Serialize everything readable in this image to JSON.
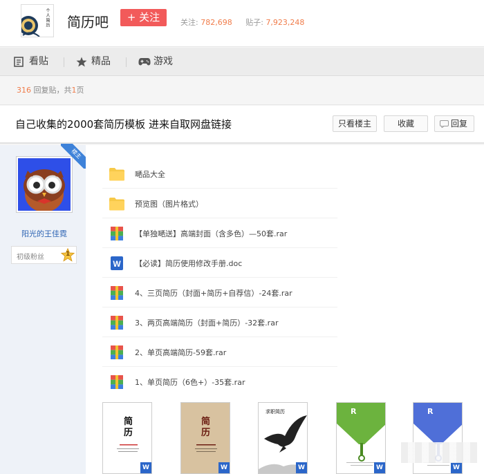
{
  "forum": {
    "logo_text": "个人简历",
    "name": "简历吧",
    "follow_label": "+ 关注",
    "follow_count_label": "关注:",
    "follow_count": "782,698",
    "post_count_label": "贴子:",
    "post_count": "7,923,248"
  },
  "tabs": [
    {
      "label": "看贴",
      "icon": "document-icon"
    },
    {
      "label": "精品",
      "icon": "star-icon"
    },
    {
      "label": "游戏",
      "icon": "gamepad-icon"
    }
  ],
  "reply_summary": {
    "count": "316",
    "reply_label": "回复贴，共",
    "pages": "1",
    "pages_suffix": "页"
  },
  "thread": {
    "title": "自己收集的2000套简历模板 进来自取网盘链接",
    "only_op_label": "只看楼主",
    "collect_label": "收藏",
    "reply_label": "回复"
  },
  "author": {
    "badge": "楼主",
    "name": "阳光的王佳霓",
    "level_label": "初级粉丝",
    "level": "1"
  },
  "files": [
    {
      "name": "嗮品大全",
      "type": "folder"
    },
    {
      "name": "预览图（图片格式）",
      "type": "folder"
    },
    {
      "name": "【单独嗮送】高端封面（含多色）—50套.rar",
      "type": "rar"
    },
    {
      "name": "【必读】简历使用修改手册.doc",
      "type": "doc"
    },
    {
      "name": "4、三页简历（封面+简历+自荐信）-24套.rar",
      "type": "rar"
    },
    {
      "name": "3、两页高端简历（封面+简历）-32套.rar",
      "type": "rar"
    },
    {
      "name": "2、单页高端简历-59套.rar",
      "type": "rar"
    },
    {
      "name": "1、单页简历（6色+）-35套.rar",
      "type": "rar"
    }
  ],
  "thumbnails": [
    {
      "title": "简历",
      "style": "white"
    },
    {
      "title": "简历",
      "style": "beige"
    },
    {
      "title": "求职简历",
      "style": "eagle"
    },
    {
      "title": "R",
      "style": "green"
    },
    {
      "title": "R",
      "style": "blue"
    }
  ],
  "colors": {
    "accent": "#f25a5a",
    "stat": "#f07c4a",
    "link": "#2d64b3",
    "word": "#2b66c9"
  }
}
